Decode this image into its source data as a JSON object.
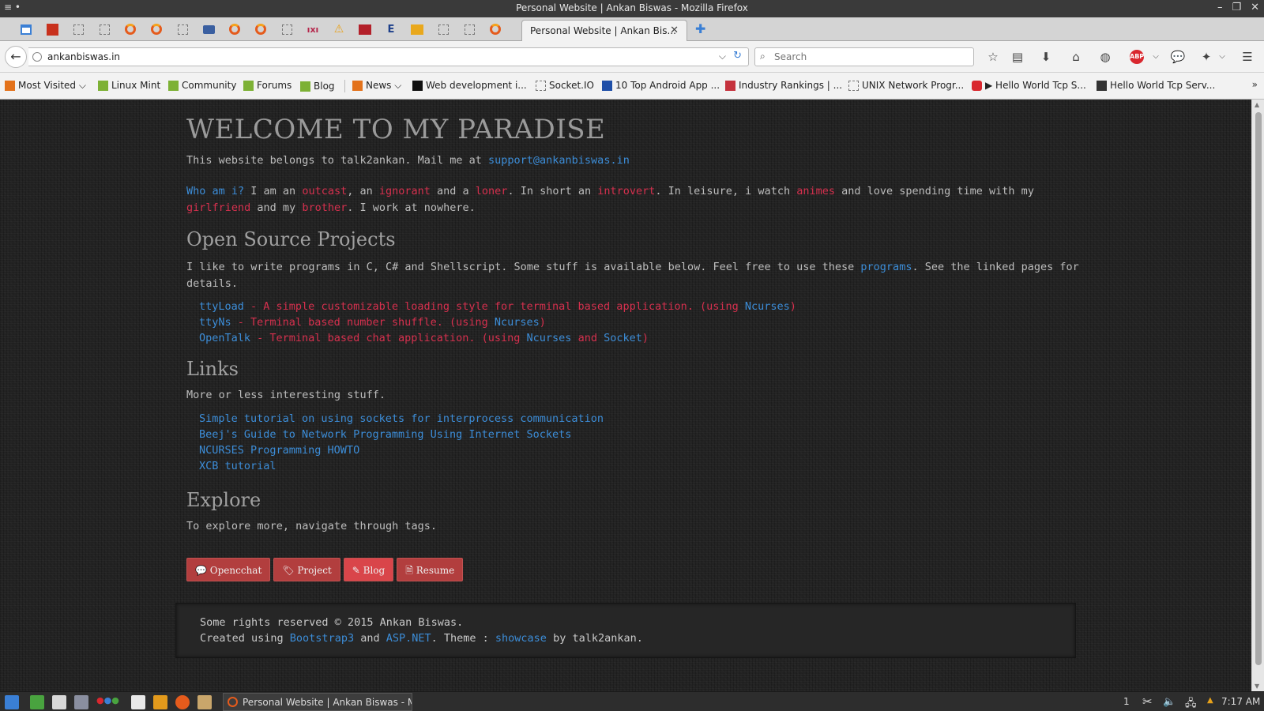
{
  "window": {
    "title": "Personal Website | Ankan Biswas - Mozilla Firefox",
    "menu_glyph": "≡  •",
    "min": "–",
    "max": "❐",
    "close": "✕"
  },
  "tabs": {
    "active_label": "Personal Website | Ankan Bis...",
    "close": "✕",
    "new_tab": "✚"
  },
  "nav": {
    "url": "ankanbiswas.in",
    "search_placeholder": "Search",
    "back": "←",
    "reload": "↻",
    "dropdown": "⌵"
  },
  "bookmarks": [
    {
      "label": "Most Visited ⌵",
      "icon_color": "#e3721b"
    },
    {
      "label": "Linux Mint",
      "icon_color": "#7db135"
    },
    {
      "label": "Community",
      "icon_color": "#7db135"
    },
    {
      "label": "Forums",
      "icon_color": "#7db135"
    },
    {
      "label": "Blog",
      "icon_color": "#7db135"
    },
    {
      "label": "News ⌵",
      "icon_color": "#e3721b"
    },
    {
      "label": "Web development i...",
      "icon_color": "#111111"
    },
    {
      "label": "Socket.IO",
      "icon_color": "#ffffff"
    },
    {
      "label": "10 Top Android App ...",
      "icon_color": "#1f4fa8"
    },
    {
      "label": "Industry Rankings | ...",
      "icon_color": "#c5323d"
    },
    {
      "label": "UNIX Network Progr...",
      "icon_color": "#ffffff"
    },
    {
      "label": "▶ Hello World Tcp S...",
      "icon_color": "#d9272e"
    },
    {
      "label": "Hello World Tcp Serv...",
      "icon_color": "#333333"
    }
  ],
  "bookmarks_more": "»",
  "page": {
    "heading": "WELCOME TO MY PARADISE",
    "intro_prefix": "This website belongs to talk2ankan. Mail me at ",
    "intro_email": "support@ankanbiswas.in",
    "about": {
      "who": "Who am i?",
      "t1": " I am an ",
      "w1": "outcast",
      "t2": ", an ",
      "w2": "ignorant",
      "t3": " and a ",
      "w3": "loner",
      "t4": ". In short an ",
      "w4": "introvert",
      "t5": ". In leisure, i watch ",
      "w5": "animes",
      "t6": " and love spending time with my",
      "w6": "girlfriend",
      "t7": " and my ",
      "w7": "brother",
      "t8": ". I work at nowhere."
    },
    "oss": {
      "title": "Open Source Projects",
      "line1_prefix": "I like to write programs in C, C# and Shellscript. Some stuff is available below. Feel free to use these ",
      "line1_link": "programs",
      "line1_suffix": ". See the linked pages for",
      "line2": "details.",
      "projects": [
        {
          "name": "ttyLoad",
          "desc": " - A simple customizable loading style for terminal based application. (using ",
          "lib": "Ncurses",
          "end": ")"
        },
        {
          "name": "ttyNs",
          "desc": " - Terminal based number shuffle. (using ",
          "lib": "Ncurses",
          "end": ")"
        },
        {
          "name": "OpenTalk",
          "desc": " - Terminal based chat application. (using ",
          "lib": "Ncurses",
          "mid": " and ",
          "lib2": "Socket",
          "end": ")"
        }
      ]
    },
    "links": {
      "title": "Links",
      "desc": "More or less interesting stuff.",
      "items": [
        "Simple tutorial on using sockets for interprocess communication",
        "Beej's Guide to Network Programming Using Internet Sockets",
        "NCURSES Programming HOWTO",
        "XCB tutorial"
      ]
    },
    "explore": {
      "title": "Explore",
      "desc": "To explore more, navigate through tags.",
      "buttons": [
        {
          "icon": "💬",
          "label": "Opencchat"
        },
        {
          "icon": "🏷",
          "label": "Project"
        },
        {
          "icon": "✎",
          "label": "Blog"
        },
        {
          "icon": "🗎",
          "label": "Resume"
        }
      ]
    },
    "footer": {
      "line1": "Some rights reserved © 2015 Ankan Biswas.",
      "l2_a": "Created using ",
      "l2_b": "Bootstrap3",
      "l2_c": " and ",
      "l2_d": "ASP.NET",
      "l2_e": ". Theme : ",
      "l2_f": "showcase",
      "l2_g": " by talk2ankan."
    }
  },
  "taskbar": {
    "task_label": "Personal Website | Ankan Biswas - Mo",
    "workspace": "1",
    "clock": "7:17 AM"
  },
  "colors": {
    "accent_red": "#d6304e",
    "link_blue": "#3c8dd8",
    "button_red": "#b23e3e"
  }
}
